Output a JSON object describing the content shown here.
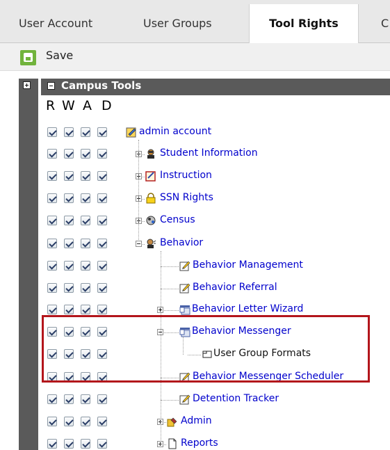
{
  "tabs": [
    {
      "label": "User Account",
      "active": false
    },
    {
      "label": "User Groups",
      "active": false
    },
    {
      "label": "Tool Rights",
      "active": true
    },
    {
      "label": "C",
      "active": false
    }
  ],
  "toolbar": {
    "save_label": "Save"
  },
  "campus_tools": {
    "title": "Campus Tools",
    "columns": [
      "R",
      "W",
      "A",
      "D"
    ]
  },
  "tree": [
    {
      "label": "admin account",
      "icon": "admin-account-icon",
      "checks": 4
    },
    {
      "label": "Student Information",
      "icon": "student-icon",
      "checks": 4
    },
    {
      "label": "Instruction",
      "icon": "instruction-icon",
      "checks": 4
    },
    {
      "label": "SSN Rights",
      "icon": "lock-icon",
      "checks": 4
    },
    {
      "label": "Census",
      "icon": "census-icon",
      "checks": 4
    },
    {
      "label": "Behavior",
      "icon": "behavior-icon",
      "checks": 4
    },
    {
      "label": "Behavior Management",
      "icon": "tool-icon",
      "checks": 4
    },
    {
      "label": "Behavior Referral",
      "icon": "tool-icon",
      "checks": 4
    },
    {
      "label": "Behavior Letter Wizard",
      "icon": "module-icon",
      "checks": 4
    },
    {
      "label": "Behavior Messenger",
      "icon": "module-icon",
      "checks": 4
    },
    {
      "label": "User Group Formats",
      "icon": "subtool-icon",
      "checks": 4
    },
    {
      "label": "Behavior Messenger Scheduler",
      "icon": "tool-icon",
      "checks": 4
    },
    {
      "label": "Detention Tracker",
      "icon": "tool-icon",
      "checks": 4
    },
    {
      "label": "Admin",
      "icon": "admin-icon",
      "checks": 4
    },
    {
      "label": "Reports",
      "icon": "reports-icon",
      "checks": 4
    }
  ],
  "colors": {
    "highlight": "#b3151b",
    "link": "#0000cc",
    "header_bg": "#5a5a5a",
    "save_green": "#71b33c"
  }
}
